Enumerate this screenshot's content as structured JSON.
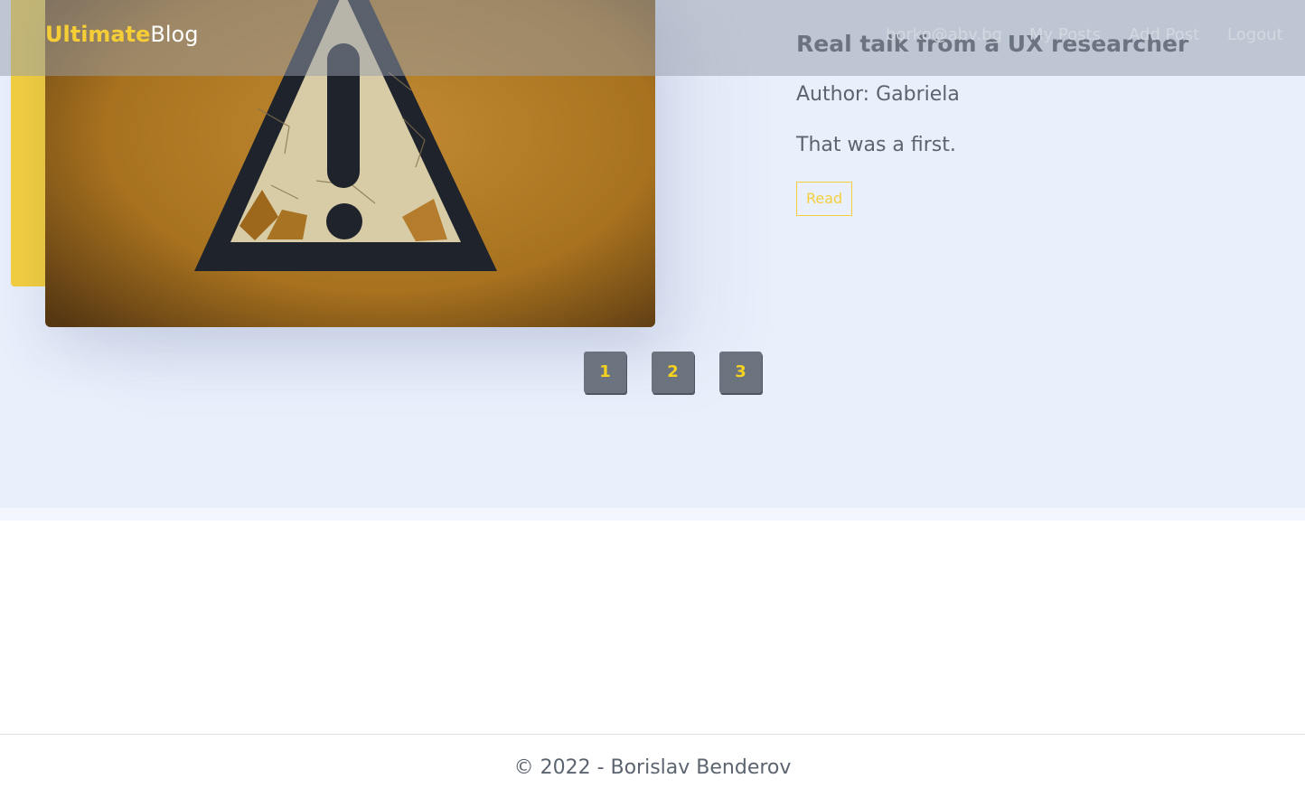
{
  "navbar": {
    "brand_part1": "Ultimate",
    "brand_part2": "Blog",
    "user_email": "borko@abv.bg",
    "links": [
      {
        "label": "My Posts"
      },
      {
        "label": "Add Post"
      },
      {
        "label": "Logout"
      }
    ]
  },
  "post": {
    "title": "Real talk from a UX researcher",
    "author": "Author: Gabriela",
    "excerpt": "That was a first.",
    "read_label": "Read",
    "image_icon": "warning-sign-icon"
  },
  "pagination": {
    "pages": [
      "1",
      "2",
      "3"
    ]
  },
  "footer": {
    "copyright": "© 2022 - Borislav Benderov"
  },
  "colors": {
    "accent_yellow": "#f3cf3f",
    "page_bg": "#e9effb",
    "page_button_bg": "#6b737e",
    "text_dark": "#414a55"
  }
}
